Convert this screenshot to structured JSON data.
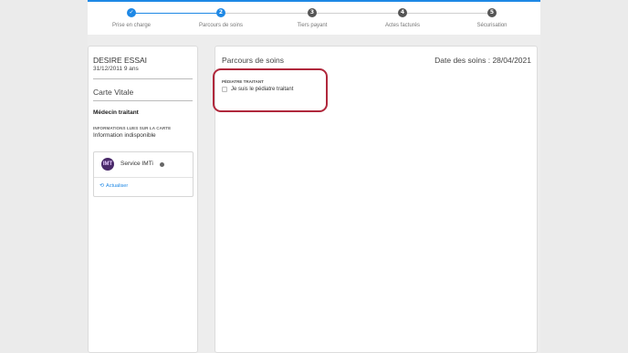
{
  "stepper": {
    "steps": [
      {
        "number": "✓",
        "label": "Prise en charge",
        "state": "done"
      },
      {
        "number": "2",
        "label": "Parcours de soins",
        "state": "current"
      },
      {
        "number": "3",
        "label": "Tiers payant",
        "state": "todo"
      },
      {
        "number": "4",
        "label": "Actes facturés",
        "state": "todo"
      },
      {
        "number": "5",
        "label": "Sécurisation",
        "state": "todo"
      }
    ]
  },
  "patient": {
    "name": "DESIRE ESSAI",
    "dob_age": "31/12/2011 9 ans"
  },
  "sidebar": {
    "carte_vitale_title": "Carte Vitale",
    "medecin_title": "Médecin traitant",
    "info_label": "INFORMATIONS LUES SUR LA CARTE",
    "info_value": "Information indisponible",
    "service": {
      "name": "Service IMTi",
      "logo_text": "IMT",
      "status_color": "#666666",
      "refresh_label": "Actualiser"
    }
  },
  "main": {
    "title": "Parcours de soins",
    "date": "Date des soins : 28/04/2021",
    "pediatre_label": "PÉDIATRE TRAITANT",
    "checkbox_label": "Je suis le pédiatre traitant",
    "checkbox_checked": false
  },
  "colors": {
    "accent": "#1e88e5",
    "highlight_border": "#b0283c"
  }
}
